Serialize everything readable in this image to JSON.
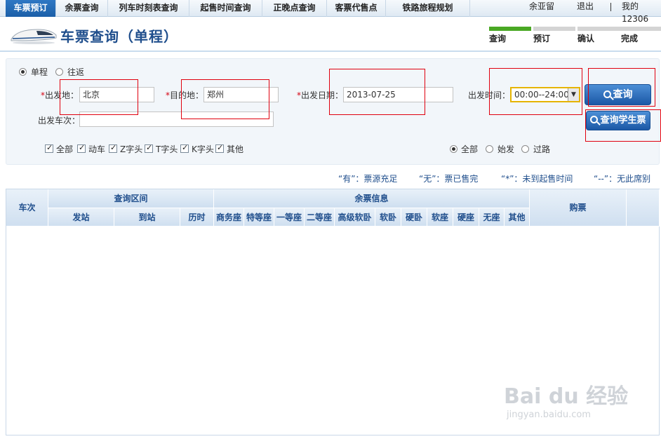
{
  "nav": {
    "tabs": [
      "车票预订",
      "余票查询",
      "列车时刻表查询",
      "起售时间查询",
      "正晚点查询",
      "客票代售点",
      "铁路旅程规划"
    ],
    "user": "余亚留",
    "logout": "退出",
    "my12306": "我的12306"
  },
  "header": {
    "title": "车票查询（单程）",
    "steps": [
      "查询",
      "预订",
      "确认",
      "完成"
    ]
  },
  "form": {
    "trip_single": "单程",
    "trip_round": "往返",
    "from_label": "出发地：",
    "from_value": "北京",
    "to_label": "目的地：",
    "to_value": "郑州",
    "date_label": "出发日期：",
    "date_value": "2013-07-25",
    "time_label": "出发时间：",
    "time_value": "00:00--24:00",
    "train_label": "出发车次：",
    "train_value": "",
    "query_button": "查询",
    "student_button": "查询学生票",
    "train_types": [
      "全部",
      "动车",
      "Z字头",
      "T字头",
      "K字头",
      "其他"
    ],
    "station_types": [
      "全部",
      "始发",
      "过路"
    ],
    "required_mark": "*"
  },
  "legend": {
    "you": "“有”：票源充足",
    "wu": "“无”：票已售完",
    "star": "“*”：未到起售时间",
    "dash": "“--”：无此席别"
  },
  "table": {
    "col_train": "车次",
    "group_range": "查询区间",
    "group_seats": "余票信息",
    "col_buy": "购票",
    "range_cols": [
      "发站",
      "到站",
      "历时"
    ],
    "seat_cols": [
      "商务座",
      "特等座",
      "一等座",
      "二等座",
      "高级软卧",
      "软卧",
      "硬卧",
      "软座",
      "硬座",
      "无座",
      "其他"
    ]
  },
  "watermark": {
    "brand": "Bai du 经验",
    "url": "jingyan.baidu.com"
  }
}
